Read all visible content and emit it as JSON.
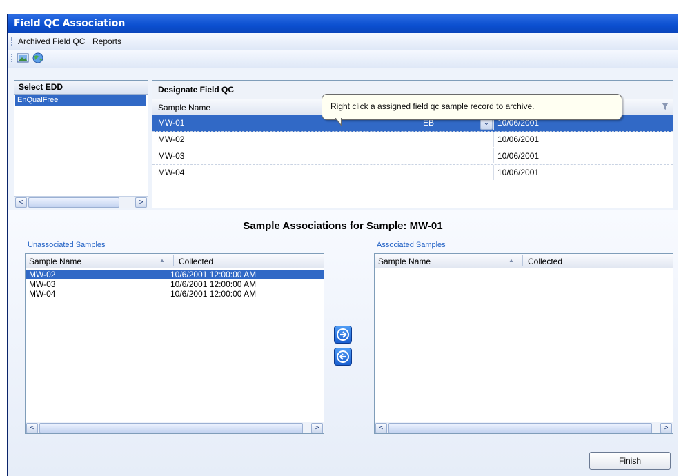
{
  "window": {
    "title": "Field QC Association"
  },
  "menu": {
    "items": [
      "Archived Field QC",
      "Reports"
    ]
  },
  "toolbar": {
    "icons": [
      "image-icon",
      "globe-icon"
    ]
  },
  "select_edd": {
    "heading": "Select EDD",
    "items": [
      "EnQualFree"
    ],
    "selected_index": 0
  },
  "designate": {
    "heading": "Designate Field QC",
    "column_sample_name": "Sample Name",
    "rows": [
      {
        "name": "MW-01",
        "qc_type": "EB",
        "date": "10/06/2001",
        "selected": true
      },
      {
        "name": "MW-02",
        "qc_type": "",
        "date": "10/06/2001",
        "selected": false
      },
      {
        "name": "MW-03",
        "qc_type": "",
        "date": "10/06/2001",
        "selected": false
      },
      {
        "name": "MW-04",
        "qc_type": "",
        "date": "10/06/2001",
        "selected": false
      }
    ]
  },
  "tooltip": {
    "text": "Right click a assigned field qc sample record to archive."
  },
  "associations": {
    "title": "Sample Associations for Sample: MW-01",
    "unassociated": {
      "label": "Unassociated Samples",
      "col_name": "Sample Name",
      "col_collected": "Collected",
      "rows": [
        {
          "name": "MW-02",
          "collected": "10/6/2001 12:00:00 AM",
          "selected": true
        },
        {
          "name": "MW-03",
          "collected": "10/6/2001 12:00:00 AM",
          "selected": false
        },
        {
          "name": "MW-04",
          "collected": "10/6/2001 12:00:00 AM",
          "selected": false
        }
      ]
    },
    "associated": {
      "label": "Associated Samples",
      "col_name": "Sample Name",
      "col_collected": "Collected",
      "rows": []
    }
  },
  "buttons": {
    "finish": "Finish",
    "move_right_icon": "arrow-right-icon",
    "move_left_icon": "arrow-left-icon"
  },
  "colors": {
    "selection": "#3169c6",
    "title_bar": "#0b4fd0",
    "group_label": "#1f5fc4"
  }
}
